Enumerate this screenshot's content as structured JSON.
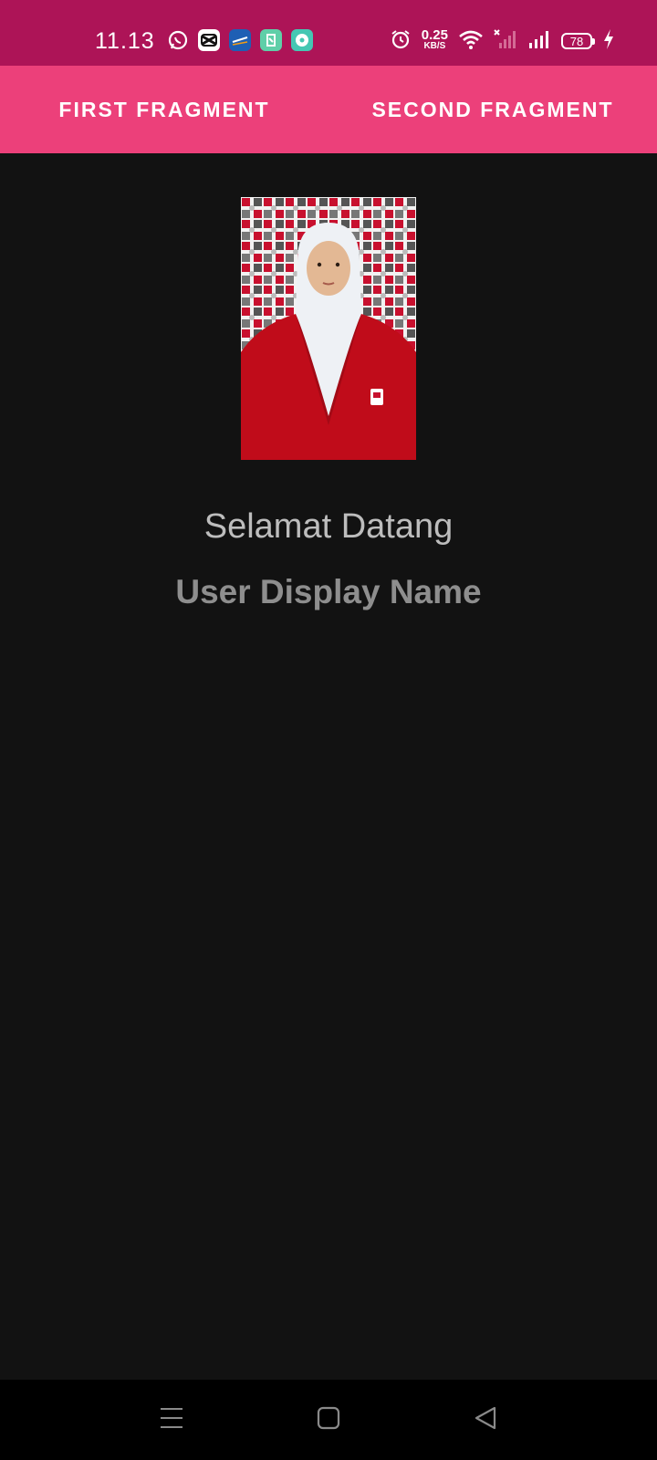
{
  "status_bar": {
    "time": "11.13",
    "net_speed_value": "0.25",
    "net_speed_unit": "KB/S",
    "battery_level": "78",
    "notification_icons": [
      "whatsapp-icon",
      "capcut-icon",
      "kai-access-icon",
      "app-icon",
      "messenger-icon"
    ],
    "system_icons": [
      "alarm-icon",
      "wifi-icon",
      "signal-no-service-icon",
      "signal-icon",
      "battery-icon",
      "charging-icon"
    ]
  },
  "tabs": [
    {
      "label": "FIRST FRAGMENT"
    },
    {
      "label": "SECOND FRAGMENT"
    }
  ],
  "content": {
    "greeting": "Selamat Datang",
    "user_name": "User Display Name"
  },
  "nav_bar": {
    "buttons": [
      "menu-icon",
      "home-icon",
      "back-icon"
    ]
  },
  "colors": {
    "status_bar": "#ad1457",
    "tab_bar": "#ec407a",
    "background": "#121212",
    "greeting_text": "#bdbdbd",
    "user_name_text": "#8e8e8e"
  }
}
